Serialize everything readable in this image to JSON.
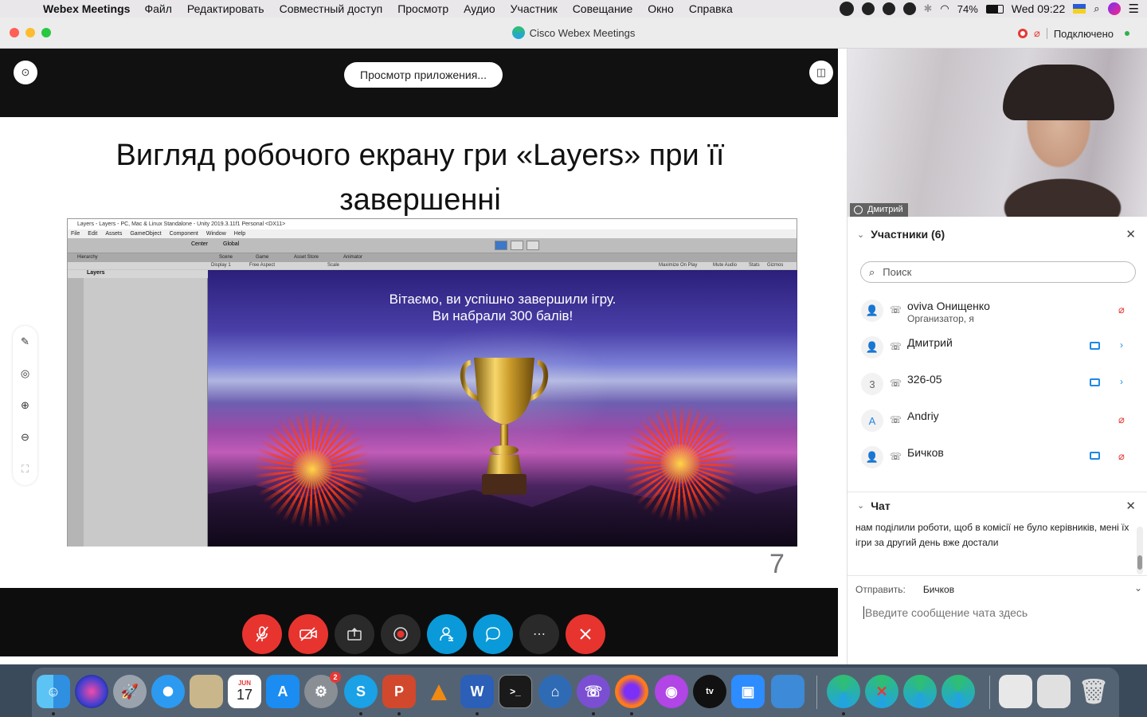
{
  "menubar": {
    "app_name": "Webex Meetings",
    "items": [
      "Файл",
      "Редактировать",
      "Совместный доступ",
      "Просмотр",
      "Аудио",
      "Участник",
      "Совещание",
      "Окно",
      "Справка"
    ],
    "battery": "74%",
    "clock": "Wed 09:22"
  },
  "window": {
    "title": "Cisco Webex Meetings",
    "status": "Подключено"
  },
  "share": {
    "view_app_button": "Просмотр приложения...",
    "slide_title": "Вигляд робочого екрану гри «Layers» при її завершенні",
    "slide_number": "7",
    "unity": {
      "title": "Layers - Layers - PC, Mac & Linux Standalone - Unity 2019.3.11f1 Personal <DX11>",
      "menu": [
        "File",
        "Edit",
        "Assets",
        "GameObject",
        "Component",
        "Window",
        "Help"
      ],
      "tabs": [
        "Hierarchy",
        "Scene",
        "Game",
        "Asset Store",
        "Animator"
      ],
      "display": "Display 1",
      "aspect": "Free Aspect",
      "scale": "Scale",
      "options": [
        "Maximize On Play",
        "Mute Audio",
        "Stats",
        "Gizmos"
      ],
      "hierarchy_root": "Layers",
      "toolbar_center": "Center",
      "toolbar_global": "Global"
    },
    "game_message_line1": "Вітаємо, ви успішно завершили ігру.",
    "game_message_line2": "Ви набрали 300 балів!"
  },
  "video": {
    "name": "Дмитрий"
  },
  "participants": {
    "header": "Участники (6)",
    "search_placeholder": "Поиск",
    "list": [
      {
        "avatar": "",
        "name": "oviva Онищенко",
        "role": "Организатор, я",
        "muted": true,
        "video": false
      },
      {
        "avatar": "",
        "name": "Дмитрий",
        "role": "",
        "muted": false,
        "video": true
      },
      {
        "avatar": "3",
        "name": "326-05",
        "role": "",
        "muted": false,
        "video": true
      },
      {
        "avatar": "A",
        "name": "Andriy",
        "role": "",
        "muted": true,
        "video": false
      },
      {
        "avatar": "",
        "name": "Бичков",
        "role": "",
        "muted": true,
        "video": true
      }
    ]
  },
  "chat": {
    "header": "Чат",
    "message": "нам поділили роботи, щоб в комісії не було керівників, мені їх ігри за другий день вже достали",
    "send_to_label": "Отправить:",
    "send_to_value": "Бичков",
    "input_placeholder": "Введите сообщение чата здесь"
  },
  "dock": {
    "calendar_month": "JUN",
    "calendar_day": "17",
    "sysprefs_badge": "2"
  },
  "colors": {
    "end_red": "#e8342f",
    "accent_blue": "#0a9ad9",
    "status_green": "#2bb34a"
  }
}
